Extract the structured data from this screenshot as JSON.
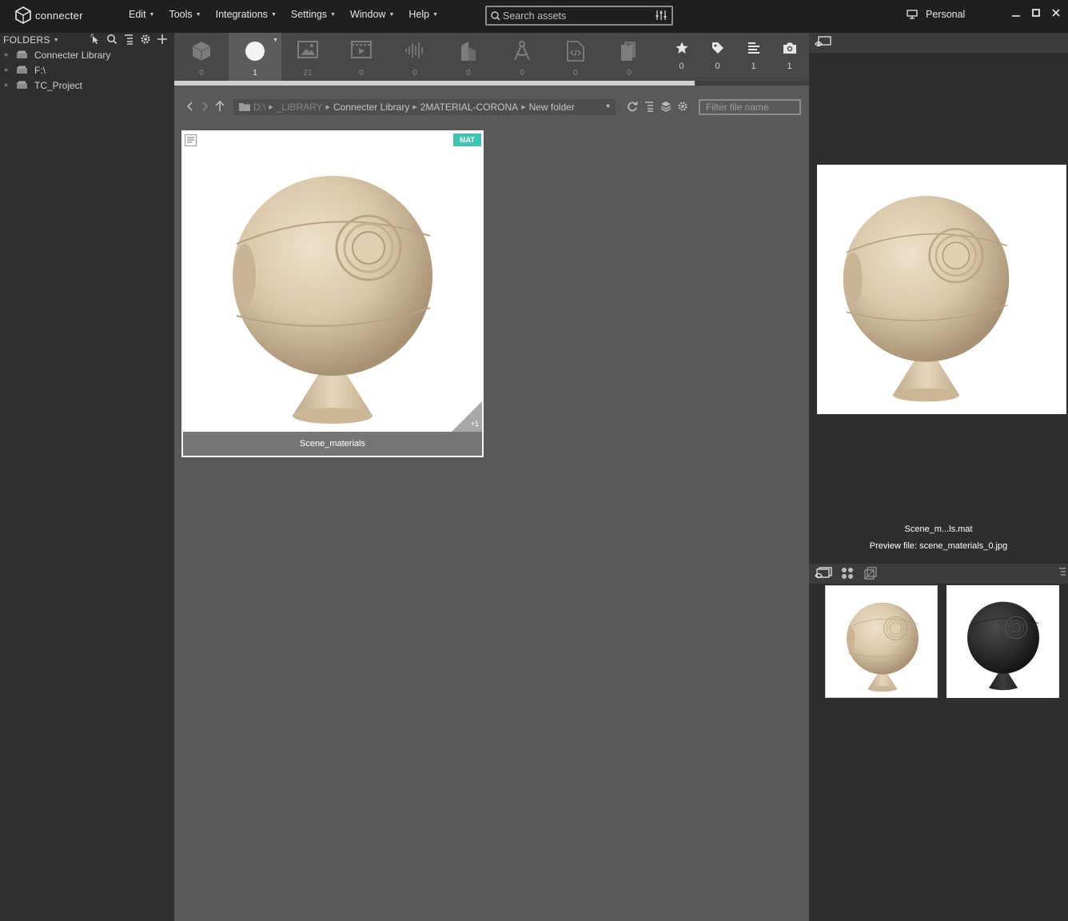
{
  "app": {
    "name": "connecter"
  },
  "menu": [
    {
      "label": "Edit"
    },
    {
      "label": "Tools"
    },
    {
      "label": "Integrations"
    },
    {
      "label": "Settings"
    },
    {
      "label": "Window"
    },
    {
      "label": "Help"
    }
  ],
  "search": {
    "placeholder": "Search assets"
  },
  "workspace": {
    "label": "Personal"
  },
  "sidebar": {
    "title": "FOLDERS",
    "items": [
      {
        "label": "Connecter Library"
      },
      {
        "label": "F:\\"
      },
      {
        "label": "TC_Project"
      }
    ]
  },
  "type_filters": [
    {
      "name": "models",
      "count": "0",
      "active": false
    },
    {
      "name": "materials",
      "count": "1",
      "active": true
    },
    {
      "name": "images",
      "count": "21",
      "active": false
    },
    {
      "name": "videos",
      "count": "0",
      "active": false
    },
    {
      "name": "audio",
      "count": "0",
      "active": false
    },
    {
      "name": "architecture",
      "count": "0",
      "active": false
    },
    {
      "name": "drawings",
      "count": "0",
      "active": false
    },
    {
      "name": "code",
      "count": "0",
      "active": false
    },
    {
      "name": "documents",
      "count": "0",
      "active": false
    }
  ],
  "meta_filters": [
    {
      "name": "favorites",
      "count": "0"
    },
    {
      "name": "tags",
      "count": "0"
    },
    {
      "name": "notes",
      "count": "1"
    },
    {
      "name": "previews",
      "count": "1"
    }
  ],
  "scan_progress": 0.82,
  "path": {
    "segments": [
      "D:\\",
      "_LIBRARY",
      "Connecter Library",
      "2MATERIAL-CORONA",
      "New folder"
    ]
  },
  "filter": {
    "placeholder": "Filter file name"
  },
  "asset": {
    "badge": "MAT",
    "extra_count": "+1",
    "label": "Scene_materials"
  },
  "preview": {
    "file_name": "Scene_m...ls.mat",
    "preview_file_label": "Preview file:",
    "preview_file_value": "scene_materials_0.jpg"
  },
  "colors": {
    "titlebar": "#1f1f1f",
    "sidebar": "#2f2f2f",
    "main": "#595959",
    "badge": "#3ec3b4",
    "wood": "#d8c7ac"
  }
}
